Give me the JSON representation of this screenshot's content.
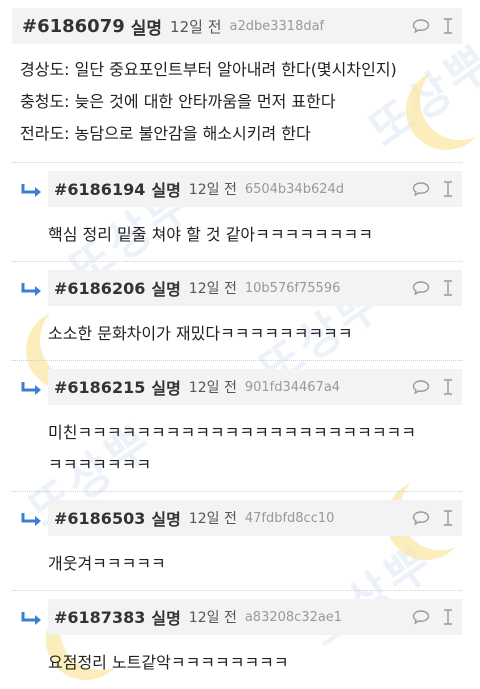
{
  "watermark": {
    "text": "또상뿌"
  },
  "colors": {
    "reply_arrow": "#3b7fd4",
    "header_bg": "#f3f3f3",
    "hash_text": "#999999"
  },
  "icons": {
    "comment": "speech-bubble-icon",
    "edit": "text-cursor-icon",
    "reply": "reply-arrow-icon"
  },
  "comments": [
    {
      "id": "#6186079",
      "author": "실명",
      "time": "12일 전",
      "hash": "a2dbe3318daf",
      "lines": [
        "경상도: 일단 중요포인트부터 알아내려 한다(몇시차인지)",
        "충청도: 늦은 것에 대한 안타까움을 먼저 표한다",
        "전라도: 농담으로 불안감을 해소시키려 한다"
      ]
    },
    {
      "id": "#6186194",
      "author": "실명",
      "time": "12일 전",
      "hash": "6504b34b624d",
      "lines": [
        "핵심 정리 밑줄 쳐야 할 것 같아ㅋㅋㅋㅋㅋㅋㅋㅋ"
      ]
    },
    {
      "id": "#6186206",
      "author": "실명",
      "time": "12일 전",
      "hash": "10b576f75596",
      "lines": [
        "소소한 문화차이가 재밌다ㅋㅋㅋㅋㅋㅋㅋㅋㅋ"
      ]
    },
    {
      "id": "#6186215",
      "author": "실명",
      "time": "12일 전",
      "hash": "901fd34467a4",
      "lines": [
        "미친ㅋㅋㅋㅋㅋㅋㅋㅋㅋㅋㅋㅋㅋㅋㅋㅋㅋㅋㅋㅋㅋㅋㅋ",
        "ㅋㅋㅋㅋㅋㅋㅋ"
      ]
    },
    {
      "id": "#6186503",
      "author": "실명",
      "time": "12일 전",
      "hash": "47fdbfd8cc10",
      "lines": [
        "개웃겨ㅋㅋㅋㅋㅋ"
      ]
    },
    {
      "id": "#6187383",
      "author": "실명",
      "time": "12일 전",
      "hash": "a83208c32ae1",
      "lines": [
        "요점정리 노트같악ㅋㅋㅋㅋㅋㅋㅋㅋ"
      ]
    }
  ]
}
